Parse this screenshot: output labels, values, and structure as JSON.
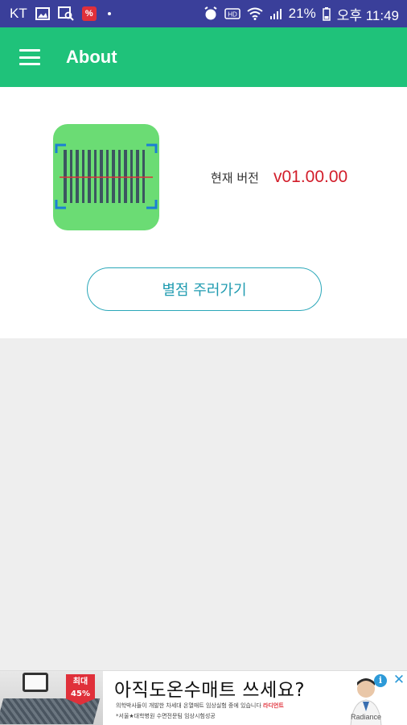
{
  "status_bar": {
    "carrier": "KT",
    "battery": "21%",
    "time": "오후 11:49",
    "background": "#3a3f9a"
  },
  "app_bar": {
    "title": "About",
    "color": "#1fc27a",
    "menu_icon": "hamburger-menu-icon"
  },
  "about": {
    "version_label": "현재 버전",
    "version_value": "v01.00.00",
    "rate_button_label": "별점 주러가기",
    "logo_icon": "barcode-scanner-icon"
  },
  "ad": {
    "badge_line1": "최대",
    "badge_line2": "45%",
    "headline": "아직도온수매트 쓰세요?",
    "sub_text_prefix": "의학박사들이 개발한 차세대 온열매트 임상실험 중에 있습니다",
    "sub_text_highlight": "라디언트",
    "sub_text_2": "*서울★대학병원 수면전문팀 임상시험성공",
    "brand": "Radiance"
  }
}
